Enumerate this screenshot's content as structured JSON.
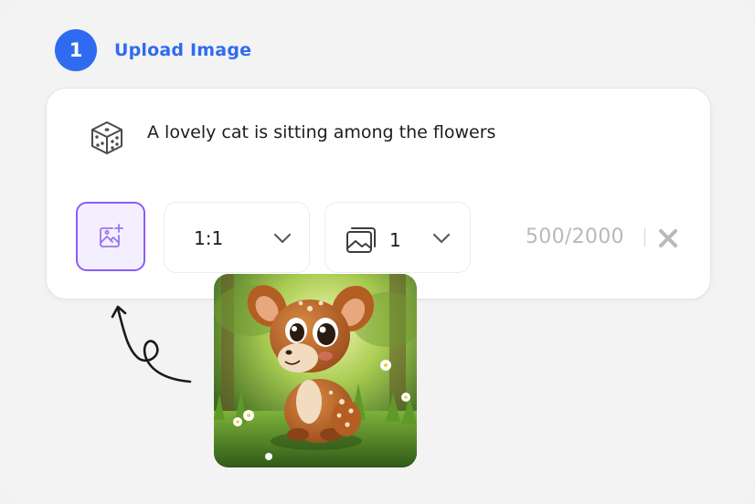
{
  "step": {
    "number": "1",
    "title": "Upload Image"
  },
  "prompt": {
    "text": "A lovely cat is sitting among the flowers",
    "icon": "dice-icon"
  },
  "toolbar": {
    "upload_icon": "image-add-icon",
    "aspect_ratio": {
      "value": "1:1",
      "icon": "chevron-down-icon"
    },
    "image_count": {
      "value": "1",
      "icon": "images-stack-icon",
      "chevron_icon": "chevron-down-icon"
    },
    "char_counter": "500/2000",
    "clear_icon": "close-icon"
  },
  "preview": {
    "description_icon": "cartoon-fawn-image",
    "arrow_icon": "curly-arrow-icon"
  },
  "colors": {
    "accent": "#2f6bf0",
    "upload_border": "#8b5cf6",
    "upload_bg": "#f3efff",
    "muted_text": "#b8b8be"
  }
}
